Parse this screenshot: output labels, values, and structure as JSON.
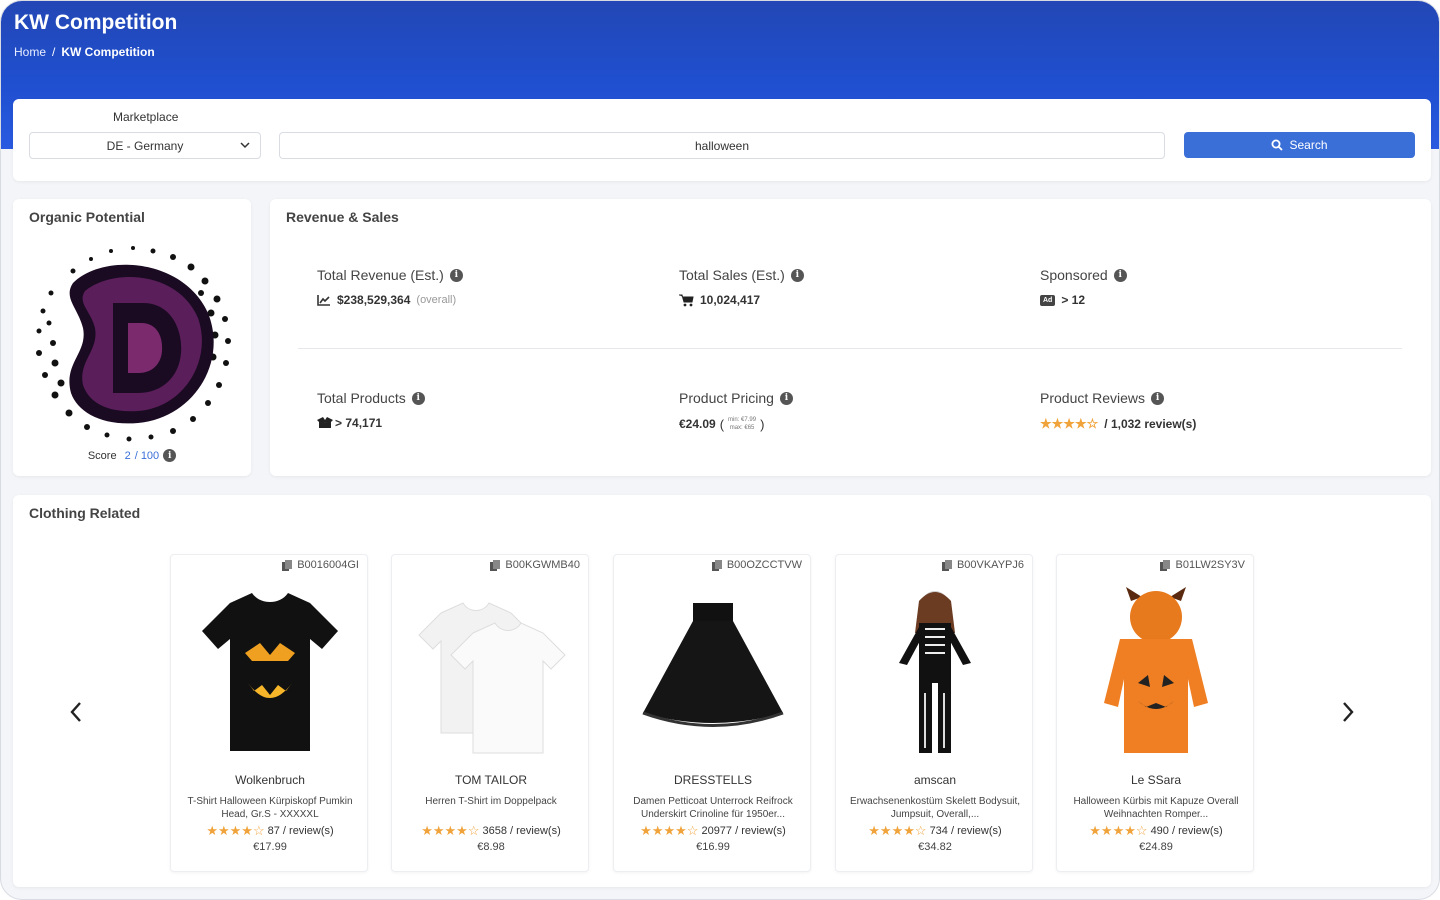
{
  "header": {
    "title": "KW Competition",
    "breadcrumb": {
      "home": "Home",
      "separator": "/",
      "current": "KW Competition"
    }
  },
  "search": {
    "marketplace_label": "Marketplace",
    "marketplace_value": "DE - Germany",
    "keyword_value": "halloween",
    "search_button": "Search"
  },
  "organic": {
    "title": "Organic Potential",
    "score_label": "Score",
    "score_value": "2",
    "score_max": "/ 100"
  },
  "revenue": {
    "title": "Revenue & Sales",
    "total_revenue_label": "Total Revenue (Est.)",
    "total_revenue_value": "$238,529,364",
    "total_revenue_sub": "(overall)",
    "total_sales_label": "Total Sales (Est.)",
    "total_sales_value": "10,024,417",
    "sponsored_label": "Sponsored",
    "sponsored_badge": "Ad",
    "sponsored_value": "> 12",
    "total_products_label": "Total Products",
    "total_products_value": "> 74,171",
    "pricing_label": "Product Pricing",
    "pricing_value": "€24.09",
    "pricing_min": "min: €7.99",
    "pricing_max": "max: €65",
    "reviews_label": "Product Reviews",
    "reviews_rating": 4,
    "reviews_value": "/  1,032 review(s)"
  },
  "clothing": {
    "title": "Clothing Related",
    "products": [
      {
        "asin": "B0016004GI",
        "brand": "Wolkenbruch",
        "title": "T-Shirt Halloween Kürpiskopf Pumkin Head, Gr.S - XXXXXL",
        "rating": 4,
        "reviews": "87 / review(s)",
        "price": "€17.99",
        "image": "tshirt-black-pumpkin"
      },
      {
        "asin": "B00KGWMB40",
        "brand": "TOM TAILOR",
        "title": "Herren T-Shirt im Doppelpack",
        "rating": 4,
        "reviews": "3658 / review(s)",
        "price": "€8.98",
        "image": "tshirt-white-pack"
      },
      {
        "asin": "B00OZCCTVW",
        "brand": "DRESSTELLS",
        "title": "Damen Petticoat Unterrock Reifrock Underskirt Crinoline für 1950er...",
        "rating": 4,
        "reviews": "20977 / review(s)",
        "price": "€16.99",
        "image": "petticoat-black"
      },
      {
        "asin": "B00VKAYPJ6",
        "brand": "amscan",
        "title": "Erwachsenenkostüm Skelett Bodysuit, Jumpsuit, Overall,...",
        "rating": 4,
        "reviews": "734 / review(s)",
        "price": "€34.82",
        "image": "skeleton-costume"
      },
      {
        "asin": "B01LW2SY3V",
        "brand": "Le SSara",
        "title": "Halloween Kürbis mit Kapuze Overall Weihnachten Romper...",
        "rating": 4,
        "reviews": "490 / review(s)",
        "price": "€24.89",
        "image": "pumpkin-romper"
      }
    ]
  },
  "colors": {
    "accent": "#3a6fd8",
    "header": "#2347b5",
    "star": "#f0a33a"
  }
}
